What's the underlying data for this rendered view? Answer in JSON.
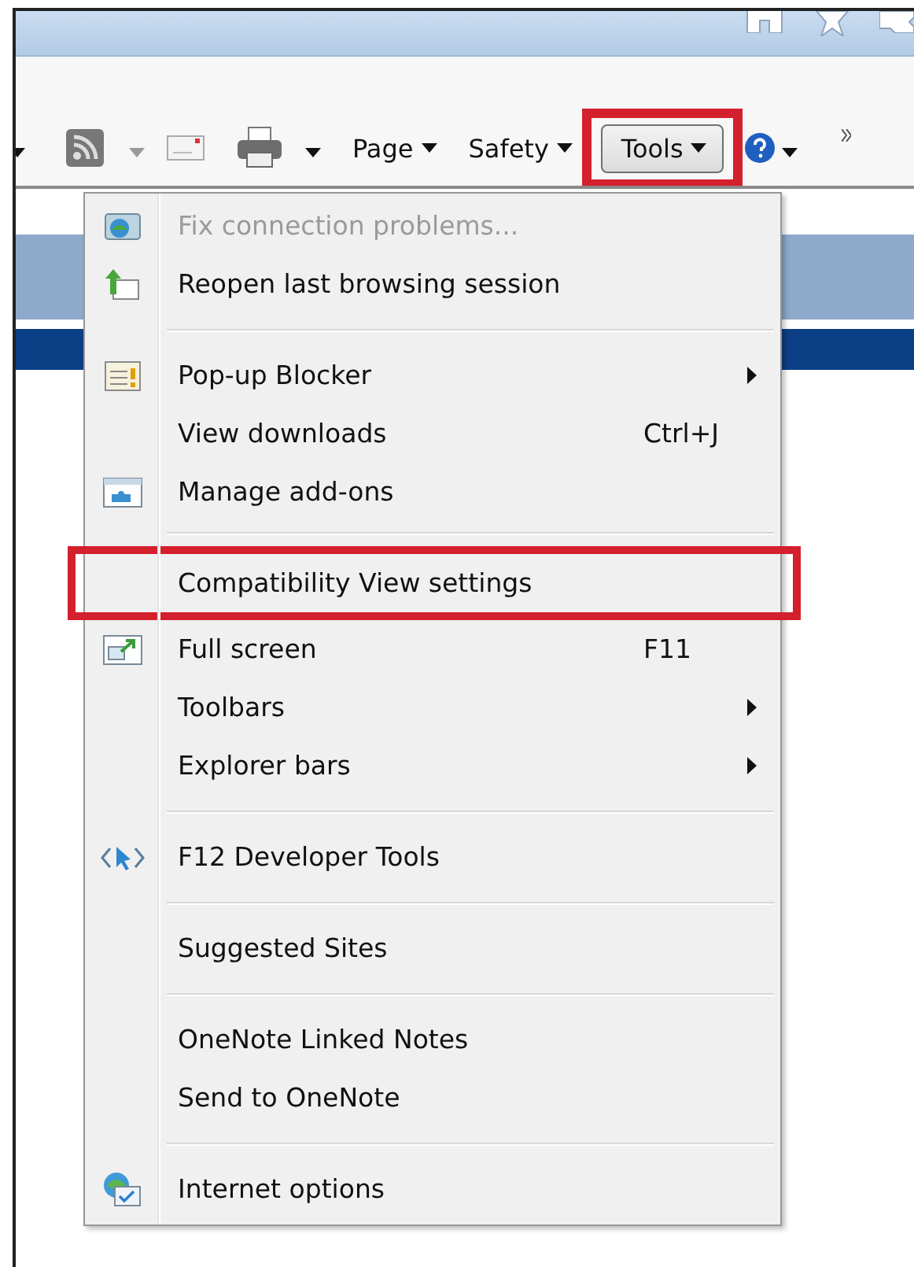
{
  "toolbar": {
    "page_menu": "Page",
    "safety_menu": "Safety",
    "tools_button": {
      "label": "Tools",
      "pressed": true,
      "highlighted": true
    }
  },
  "menu": {
    "items": [
      {
        "kind": "item",
        "label": "Fix connection problems...",
        "disabled": true,
        "submenu": false,
        "highlighted": false
      },
      {
        "kind": "item",
        "label": "Reopen last browsing session",
        "disabled": false,
        "submenu": false,
        "highlighted": false
      },
      {
        "kind": "separator"
      },
      {
        "kind": "item",
        "label": "Pop-up Blocker",
        "disabled": false,
        "submenu": true,
        "highlighted": false
      },
      {
        "kind": "item",
        "label": "View downloads",
        "shortcut": "Ctrl+J",
        "disabled": false,
        "submenu": false,
        "highlighted": false
      },
      {
        "kind": "item",
        "label": "Manage add-ons",
        "disabled": false,
        "submenu": false,
        "highlighted": false
      },
      {
        "kind": "separator"
      },
      {
        "kind": "item",
        "label": "Compatibility View settings",
        "disabled": false,
        "submenu": false,
        "highlighted": true
      },
      {
        "kind": "item",
        "label": "Full screen",
        "shortcut": "F11",
        "disabled": false,
        "submenu": false,
        "highlighted": false
      },
      {
        "kind": "item",
        "label": "Toolbars",
        "disabled": false,
        "submenu": true,
        "highlighted": false
      },
      {
        "kind": "item",
        "label": "Explorer bars",
        "disabled": false,
        "submenu": true,
        "highlighted": false
      },
      {
        "kind": "separator"
      },
      {
        "kind": "item",
        "label": "F12 Developer Tools",
        "disabled": false,
        "submenu": false,
        "highlighted": false
      },
      {
        "kind": "separator"
      },
      {
        "kind": "item",
        "label": "Suggested Sites",
        "disabled": false,
        "submenu": false,
        "highlighted": false
      },
      {
        "kind": "separator"
      },
      {
        "kind": "item",
        "label": "OneNote Linked Notes",
        "disabled": false,
        "submenu": false,
        "highlighted": false
      },
      {
        "kind": "item",
        "label": "Send to OneNote",
        "disabled": false,
        "submenu": false,
        "highlighted": false
      },
      {
        "kind": "separator"
      },
      {
        "kind": "item",
        "label": "Internet options",
        "disabled": false,
        "submenu": false,
        "highlighted": false
      }
    ]
  }
}
